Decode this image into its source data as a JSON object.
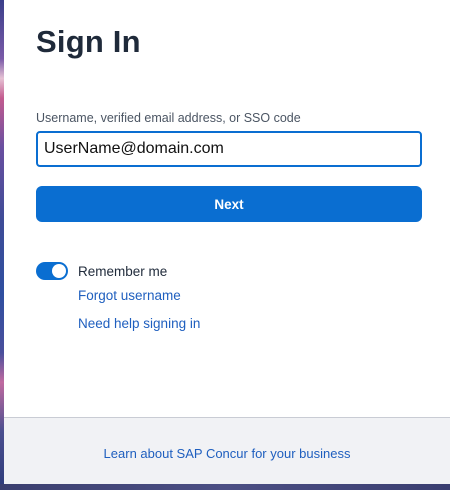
{
  "title": "Sign In",
  "login": {
    "label": "Username, verified email address, or SSO code",
    "value": "UserName@domain.com",
    "next_label": "Next"
  },
  "remember": {
    "label": "Remember me",
    "enabled": true
  },
  "links": {
    "forgot_username": "Forgot username",
    "need_help": "Need help signing in"
  },
  "footer": {
    "learn_more": "Learn about SAP Concur for your business"
  },
  "colors": {
    "accent": "#0a6ed1",
    "link": "#1f5fbf",
    "title": "#1f2a3a",
    "footer_bg": "#f1f2f5"
  }
}
